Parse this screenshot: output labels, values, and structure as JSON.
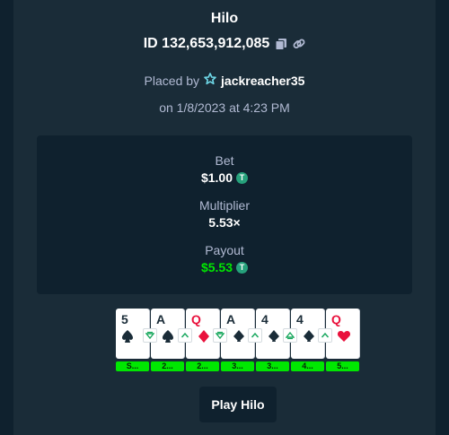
{
  "game": {
    "title": "Hilo"
  },
  "bet": {
    "id_text": "ID 132,653,912,085",
    "placed_prefix": "Placed by",
    "username": "jackreacher35",
    "date_text": "on 1/8/2023 at 4:23 PM"
  },
  "stats": {
    "bet_label": "Bet",
    "bet_value": "$1.00",
    "multiplier_label": "Multiplier",
    "multiplier_value": "5.53×",
    "payout_label": "Payout",
    "payout_value": "$5.53",
    "currency_symbol": "T",
    "currency_color": "#26a17b",
    "payout_color": "#00e701"
  },
  "cards": [
    {
      "rank": "5",
      "suit": "spade",
      "color": "black",
      "multiplier": "S..."
    },
    {
      "rank": "A",
      "suit": "spade",
      "color": "black",
      "multiplier": "2...",
      "guess": "lower"
    },
    {
      "rank": "Q",
      "suit": "diamond",
      "color": "red",
      "multiplier": "2...",
      "guess": "higher"
    },
    {
      "rank": "A",
      "suit": "club",
      "color": "black",
      "multiplier": "3...",
      "guess": "lower"
    },
    {
      "rank": "4",
      "suit": "club",
      "color": "black",
      "multiplier": "3...",
      "guess": "higher"
    },
    {
      "rank": "4",
      "suit": "club",
      "color": "black",
      "multiplier": "4...",
      "guess": "same-or-higher"
    },
    {
      "rank": "Q",
      "suit": "heart",
      "color": "red",
      "multiplier": "5...",
      "guess": "higher"
    }
  ],
  "actions": {
    "play_label": "Play Hilo"
  },
  "colors": {
    "background": "#0f212e",
    "panel": "#1a2c38",
    "muted_text": "#b1bad3",
    "multiplier_badge": "#00e701",
    "red_suit": "#e9113c",
    "black_suit": "#1a2c38"
  }
}
